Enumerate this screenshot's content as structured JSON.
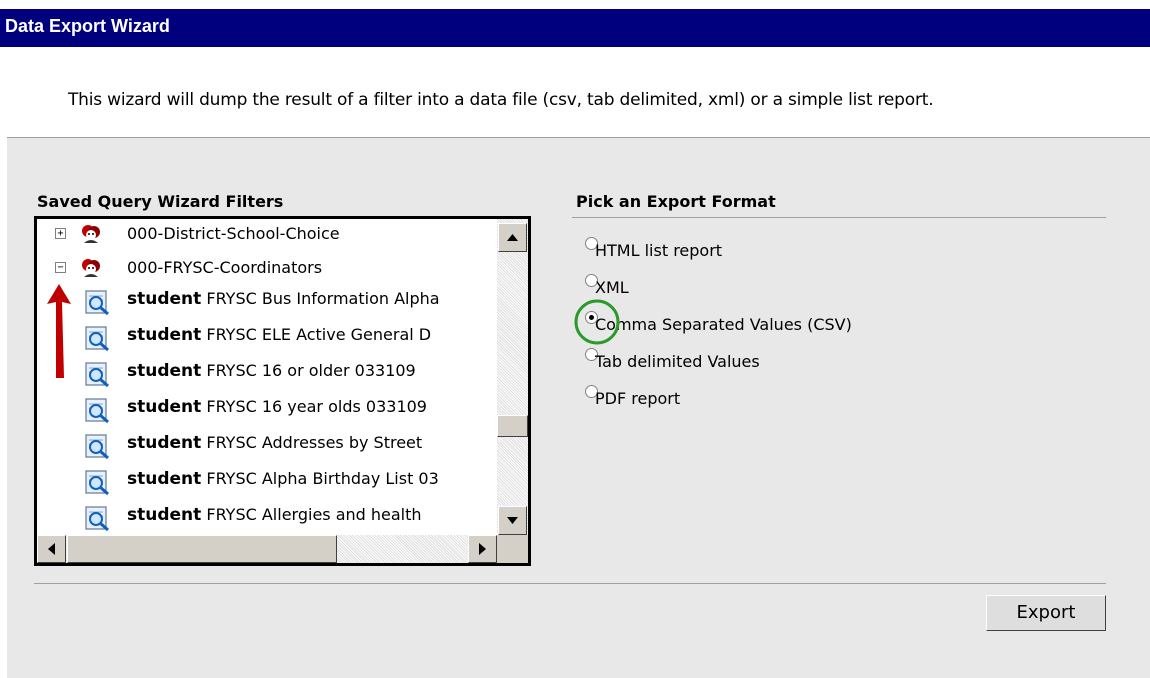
{
  "window": {
    "title": "Data Export Wizard"
  },
  "intro_text": "This wizard will dump the result of a filter into a data file (csv, tab delimited, xml) or a simple list report.",
  "filters": {
    "title": "Saved Query Wizard Filters",
    "folders": [
      {
        "label": "000-District-School-Choice",
        "expander": "+"
      },
      {
        "label": "000-FRYSC-Coordinators",
        "expander": "−"
      }
    ],
    "queries": [
      {
        "type": "student",
        "name": " FRYSC Bus Information Alpha"
      },
      {
        "type": "student",
        "name": " FRYSC ELE Active General D"
      },
      {
        "type": "student",
        "name": "FRYSC 16 or older 033109"
      },
      {
        "type": "student",
        "name": "FRYSC 16 year olds 033109"
      },
      {
        "type": "student",
        "name": "FRYSC Addresses by Street"
      },
      {
        "type": "student",
        "name": "FRYSC Alpha Birthday List 03"
      },
      {
        "type": "student",
        "name": "FRYSC Allergies and health"
      }
    ]
  },
  "format": {
    "title": "Pick an Export Format",
    "options": [
      {
        "label": "HTML list report",
        "checked": false
      },
      {
        "label": "XML",
        "checked": false
      },
      {
        "label": "Comma Separated Values (CSV)",
        "checked": true
      },
      {
        "label": "Tab delimited Values",
        "checked": false
      },
      {
        "label": "PDF report",
        "checked": false
      }
    ]
  },
  "buttons": {
    "export": "Export"
  },
  "colors": {
    "titlebar": "#00007f",
    "annotation_arrow": "#c00000",
    "annotation_circle": "#2a9a2a"
  },
  "icons": [
    "plus-expander-icon",
    "minus-expander-icon",
    "folder-user-icon",
    "query-magnifier-icon",
    "scroll-up-icon",
    "scroll-down-icon",
    "scroll-left-icon",
    "scroll-right-icon"
  ]
}
